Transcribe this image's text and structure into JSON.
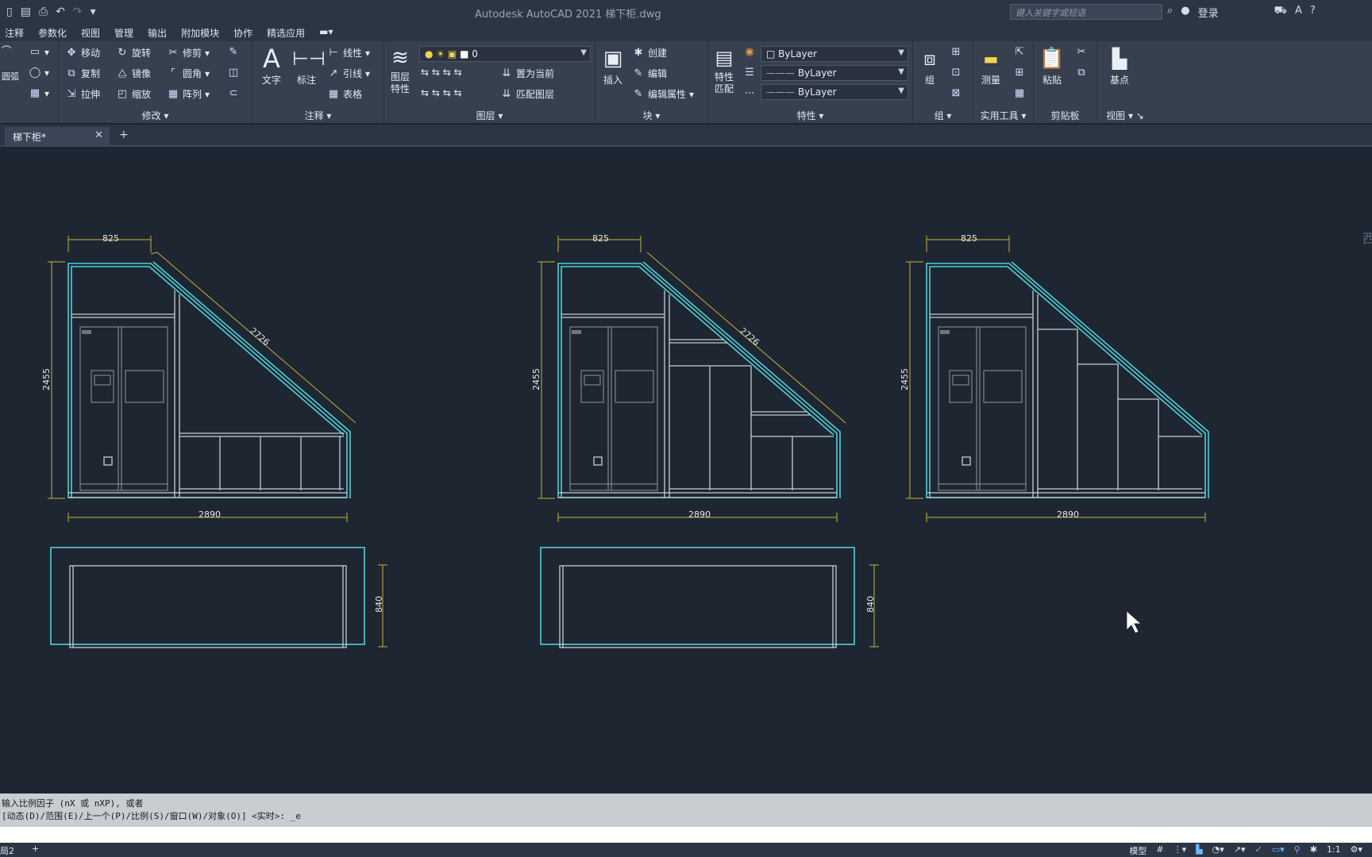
{
  "window": {
    "title": "Autodesk AutoCAD 2021    梯下柜.dwg",
    "search_placeholder": "键入关键字或短语",
    "login": "登录"
  },
  "menu": [
    "注释",
    "参数化",
    "视图",
    "管理",
    "输出",
    "附加模块",
    "协作",
    "精选应用"
  ],
  "ribbon": {
    "draw_partial_label": "圆弧",
    "modify": {
      "title": "修改",
      "items": [
        "移动",
        "旋转",
        "修剪",
        "复制",
        "镜像",
        "圆角",
        "拉伸",
        "缩放",
        "阵列"
      ]
    },
    "annotation": {
      "title": "注释",
      "text": "文字",
      "dim": "标注",
      "linear": "线性",
      "leader": "引线",
      "table": "表格"
    },
    "layers": {
      "title": "图层",
      "props": "图层\n特性",
      "current_layer": "0",
      "set_current": "置为当前",
      "match_layer": "匹配图层"
    },
    "block": {
      "title": "块",
      "insert": "插入",
      "create": "创建",
      "edit": "编辑",
      "edit_attr": "编辑属性"
    },
    "properties": {
      "title": "特性",
      "match": "特性\n匹配",
      "color": "ByLayer",
      "linetype": "ByLayer",
      "lineweight": "ByLayer"
    },
    "groups": {
      "title": "组",
      "group": "组"
    },
    "utilities": {
      "title": "实用工具",
      "measure": "测量"
    },
    "clipboard": {
      "title": "剪贴板",
      "paste": "粘贴"
    },
    "view": {
      "title": "视图",
      "basepoint": "基点"
    }
  },
  "tabs": {
    "doc": "梯下柜*"
  },
  "drawing": {
    "views": [
      {
        "top_dim": "825",
        "diag_dim": "2726",
        "height_dim": "2455",
        "width_dim": "2890"
      },
      {
        "top_dim": "825",
        "diag_dim": "2726",
        "height_dim": "2455",
        "width_dim": "2890"
      },
      {
        "top_dim": "825",
        "height_dim": "2455",
        "width_dim": "2890"
      }
    ],
    "plans": [
      {
        "depth_dim": "840"
      },
      {
        "depth_dim": "840"
      }
    ],
    "side_label": "西"
  },
  "command": {
    "line1": "输入比例因子 (nX 或 nXP), 或者",
    "line2": "[动态(D)/范围(E)/上一个(P)/比例(S)/窗口(W)/对象(O)] <实时>: _e"
  },
  "status": {
    "layout": "局2",
    "model": "模型",
    "scale": "1:1"
  },
  "colors": {
    "background": "#1e2632",
    "cabinet": "#4fd0d6",
    "inner": "#c7ccd2",
    "dimension": "#c8b23a"
  }
}
